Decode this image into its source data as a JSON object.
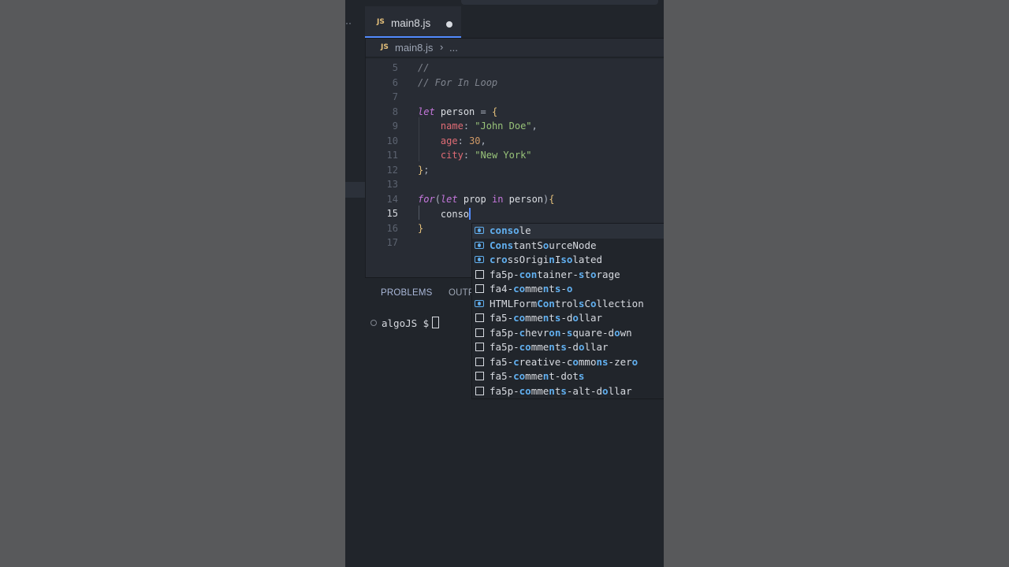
{
  "tab": {
    "icon": "JS",
    "filename": "main8.js"
  },
  "breadcrumb": {
    "icon": "JS",
    "file": "main8.js",
    "separator": "›",
    "more": "..."
  },
  "editor": {
    "lines": [
      {
        "num": "5",
        "text": "//"
      },
      {
        "num": "6",
        "text": "// For In Loop"
      },
      {
        "num": "7",
        "text": ""
      },
      {
        "num": "8",
        "text": "let person = {"
      },
      {
        "num": "9",
        "text": "    name: \"John Doe\","
      },
      {
        "num": "10",
        "text": "    age: 30,"
      },
      {
        "num": "11",
        "text": "    city: \"New York\""
      },
      {
        "num": "12",
        "text": "};"
      },
      {
        "num": "13",
        "text": ""
      },
      {
        "num": "14",
        "text": "for(let prop in person){"
      },
      {
        "num": "15",
        "text": "    conso"
      },
      {
        "num": "16",
        "text": "}"
      },
      {
        "num": "17",
        "text": ""
      }
    ]
  },
  "panel": {
    "tab_problems": "PROBLEMS",
    "tab_output": "OUTP",
    "terminal_prompt": "algoJS $"
  },
  "suggestions": [
    {
      "label": "console",
      "kind": "variable"
    },
    {
      "label": "ConstantSourceNode",
      "kind": "variable"
    },
    {
      "label": "crossOriginIsolated",
      "kind": "variable"
    },
    {
      "label": "fa5p-container-storage",
      "kind": "text"
    },
    {
      "label": "fa4-comments-o",
      "kind": "text"
    },
    {
      "label": "HTMLFormControlsCollection",
      "kind": "variable"
    },
    {
      "label": "fa5-comments-dollar",
      "kind": "text"
    },
    {
      "label": "fa5p-chevron-square-down",
      "kind": "text"
    },
    {
      "label": "fa5p-comments-dollar",
      "kind": "text"
    },
    {
      "label": "fa5-creative-commons-zero",
      "kind": "text"
    },
    {
      "label": "fa5-comment-dots",
      "kind": "text"
    },
    {
      "label": "fa5p-comments-alt-dollar",
      "kind": "text"
    }
  ],
  "colors": {
    "accent": "#528bff",
    "background": "#282c34"
  }
}
